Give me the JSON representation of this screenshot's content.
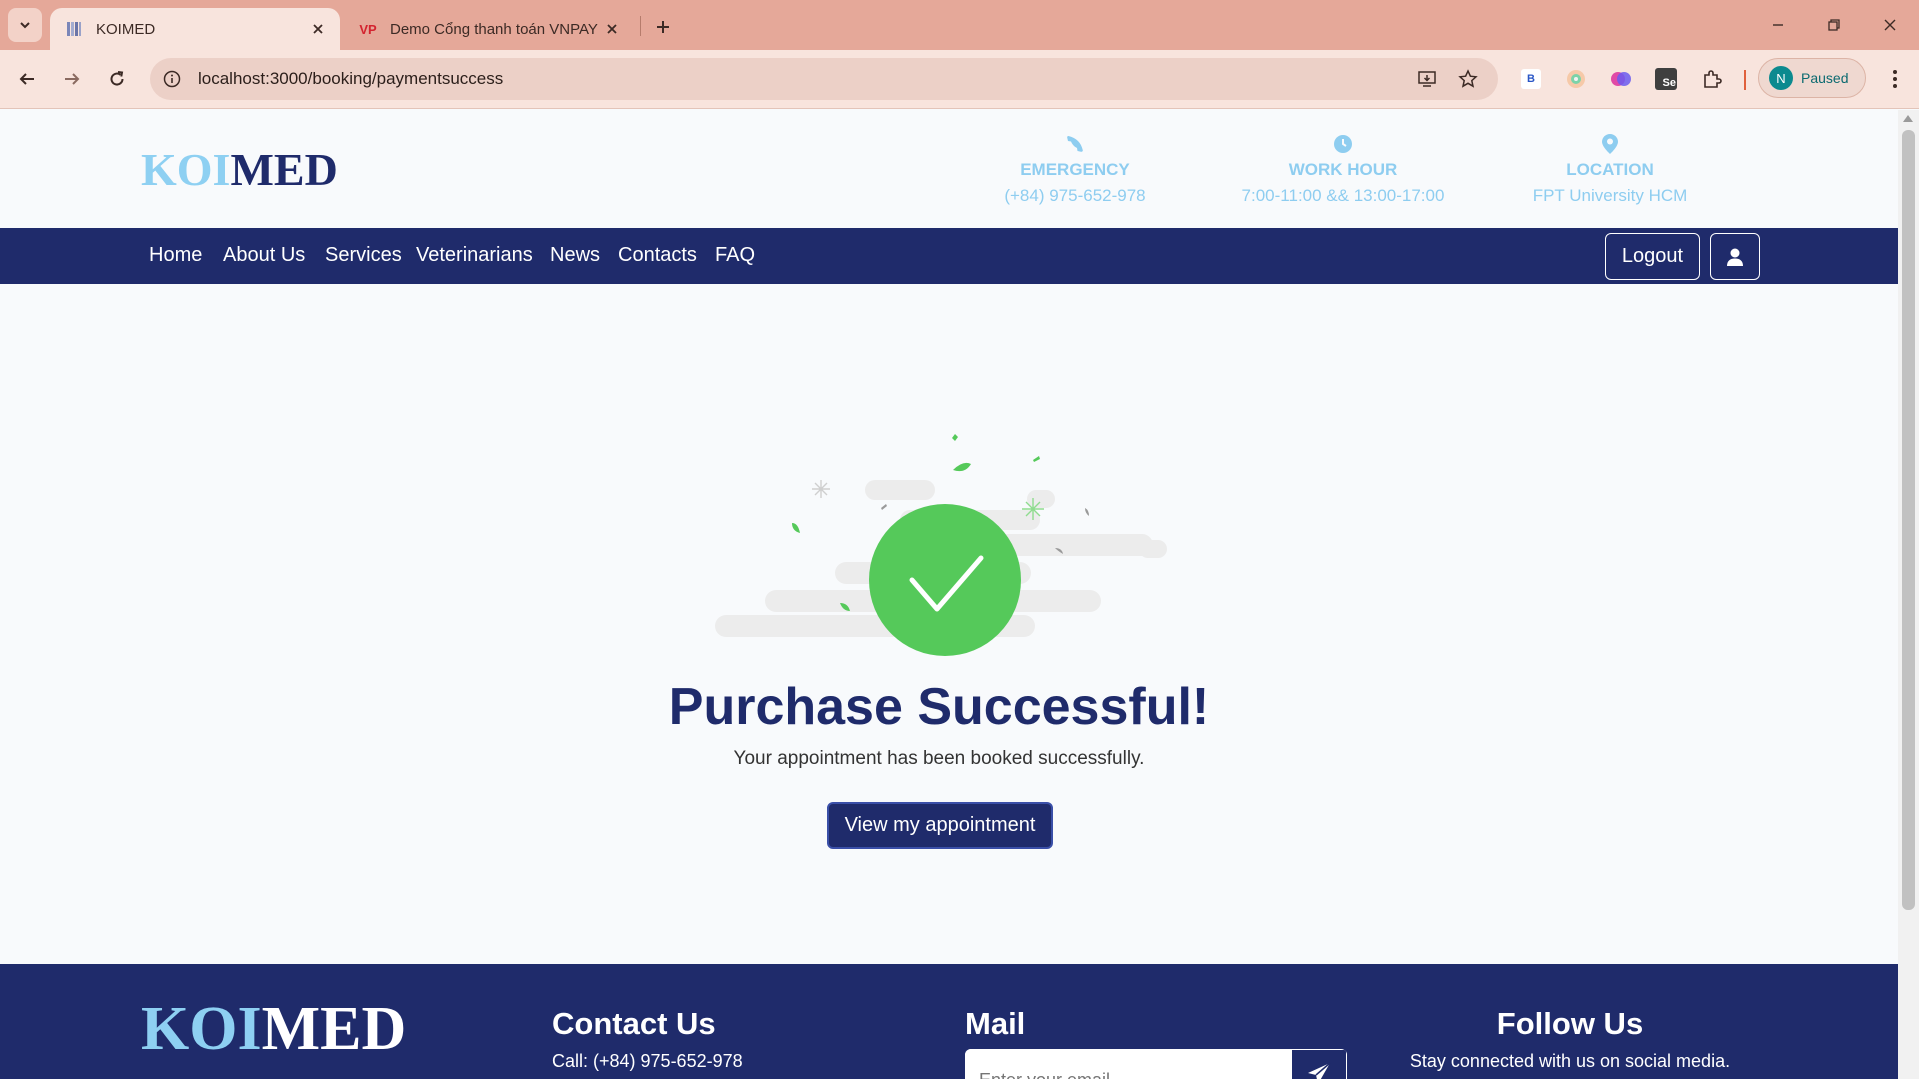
{
  "browser": {
    "tabs": [
      {
        "title": "KOIMED",
        "active": true
      },
      {
        "title": "Demo Cổng thanh toán VNPAY",
        "active": false,
        "favicon_text": "VP"
      }
    ],
    "url": "localhost:3000/booking/paymentsuccess",
    "extensions": [
      "B",
      "Se"
    ],
    "profile": {
      "initial": "N",
      "status": "Paused"
    }
  },
  "header": {
    "logo": {
      "part1": "KOI",
      "part2": "MED"
    },
    "info": [
      {
        "icon": "phone-icon",
        "heading": "EMERGENCY",
        "value": "(+84) 975-652-978"
      },
      {
        "icon": "clock-icon",
        "heading": "WORK HOUR",
        "value": "7:00-11:00 && 13:00-17:00"
      },
      {
        "icon": "location-pin-icon",
        "heading": "LOCATION",
        "value": "FPT University HCM"
      }
    ]
  },
  "nav": {
    "links": [
      "Home",
      "About Us",
      "Services",
      "Veterinarians",
      "News",
      "Contacts",
      "FAQ"
    ],
    "logout_label": "Logout"
  },
  "main": {
    "title": "Purchase Successful!",
    "subtitle": "Your appointment has been booked successfully.",
    "button_label": "View my appointment"
  },
  "footer": {
    "logo": {
      "part1": "KOI",
      "part2": "MED"
    },
    "contact": {
      "heading": "Contact Us",
      "text": "Call: (+84) 975-652-978"
    },
    "mail": {
      "heading": "Mail",
      "placeholder": "Enter your email"
    },
    "follow": {
      "heading": "Follow Us",
      "text": "Stay connected with us on social media."
    }
  },
  "colors": {
    "brand_navy": "#1f2b6b",
    "brand_light_blue": "#8ed0f2",
    "success_green": "#55c95a"
  }
}
